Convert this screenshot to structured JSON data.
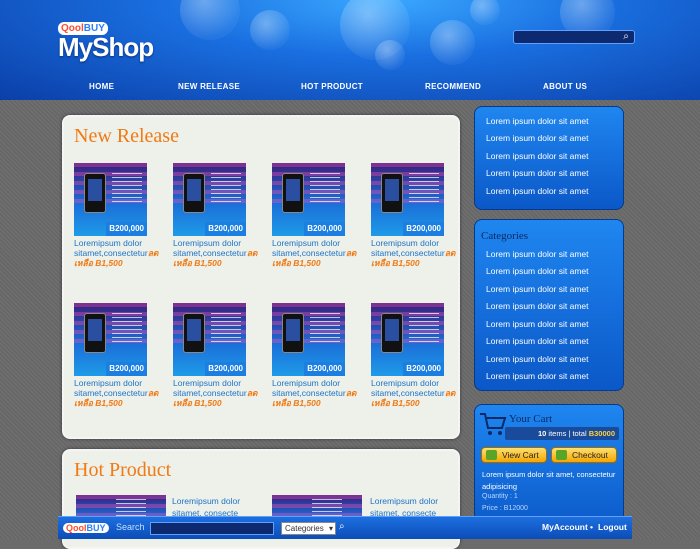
{
  "brand": {
    "qool_a": "Qool",
    "qool_b": "BUY",
    "name": "MyShop"
  },
  "nav": [
    "HOME",
    "NEW RELEASE",
    "HOT PRODUCT",
    "RECOMMEND",
    "ABOUT US"
  ],
  "new_release": {
    "title": "New Release",
    "products": [
      {
        "price": "B200,000",
        "desc": "Loremipsum dolor sitamet,consectetur",
        "sale_label": "ลดเหลือ",
        "sale_price": "B1,500"
      },
      {
        "price": "B200,000",
        "desc": "Loremipsum dolor sitamet,consectetur",
        "sale_label": "ลดเหลือ",
        "sale_price": "B1,500"
      },
      {
        "price": "B200,000",
        "desc": "Loremipsum dolor sitamet,consectetur",
        "sale_label": "ลดเหลือ",
        "sale_price": "B1,500"
      },
      {
        "price": "B200,000",
        "desc": "Loremipsum dolor sitamet,consectetur",
        "sale_label": "ลดเหลือ",
        "sale_price": "B1,500"
      },
      {
        "price": "B200,000",
        "desc": "Loremipsum dolor sitamet,consectetur",
        "sale_label": "ลดเหลือ",
        "sale_price": "B1,500"
      },
      {
        "price": "B200,000",
        "desc": "Loremipsum dolor sitamet,consectetur",
        "sale_label": "ลดเหลือ",
        "sale_price": "B1,500"
      },
      {
        "price": "B200,000",
        "desc": "Loremipsum dolor sitamet,consectetur",
        "sale_label": "ลดเหลือ",
        "sale_price": "B1,500"
      },
      {
        "price": "B200,000",
        "desc": "Loremipsum dolor sitamet,consectetur",
        "sale_label": "ลดเหลือ",
        "sale_price": "B1,500"
      }
    ]
  },
  "hot_product": {
    "title": "Hot Product",
    "items": [
      {
        "desc": "Loremipsum dolor sitamet, consecte"
      },
      {
        "desc": "Loremipsum dolor sitamet, consecte"
      }
    ]
  },
  "sidebar_links": [
    "Lorem ipsum dolor sit amet",
    "Lorem ipsum dolor sit amet",
    "Lorem ipsum dolor sit amet",
    "Lorem ipsum dolor sit amet",
    "Lorem ipsum dolor sit amet"
  ],
  "categories": {
    "title": "Categories",
    "items": [
      "Lorem ipsum dolor sit amet",
      "Lorem ipsum dolor sit amet",
      "Lorem ipsum dolor sit amet",
      "Lorem ipsum dolor sit amet",
      "Lorem ipsum dolor sit amet",
      "Lorem ipsum dolor sit amet",
      "Lorem ipsum dolor sit amet",
      "Lorem ipsum dolor sit amet"
    ]
  },
  "cart": {
    "title": "Your Cart",
    "count": "10",
    "count_suffix": " items | total ",
    "total": "B30000",
    "view_label": "View Cart",
    "checkout_label": "Checkout",
    "desc": "Lorem ipsum dolor sit amet, consectetur adipisicing",
    "quantity": "Quantity : 1",
    "price": "Price : B12000"
  },
  "bottom": {
    "search_label": "Search",
    "select_value": "Categories",
    "my_account": "MyAccount",
    "logout": "Logout"
  },
  "colors": {
    "accent": "#f07a14",
    "link": "#1d74c8",
    "header_blue": "#1a6fe0"
  }
}
